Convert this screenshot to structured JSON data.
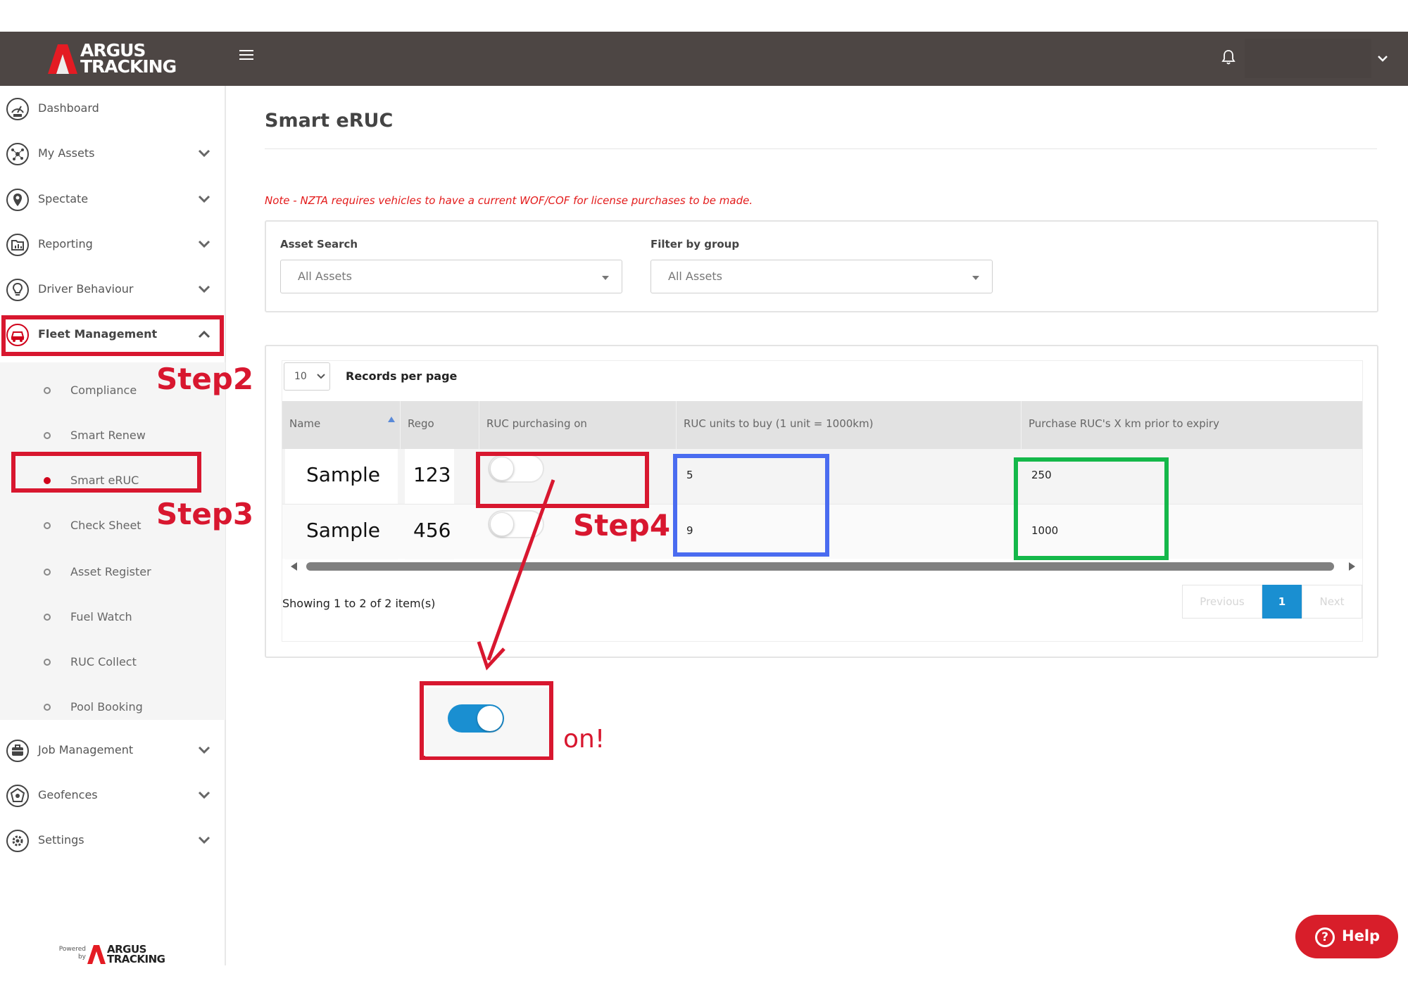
{
  "brand": {
    "line1": "ARGUS",
    "line2": "TRACKING",
    "powered_by": "Powered by",
    "accent_red": "#d0021b",
    "topbar_color": "#4d4644",
    "toggle_blue": "#1a8fd1"
  },
  "sidebar": {
    "items": [
      {
        "label": "Dashboard",
        "icon": "gauge-icon",
        "has_chevron": false
      },
      {
        "label": "My Assets",
        "icon": "network-icon",
        "has_chevron": true
      },
      {
        "label": "Spectate",
        "icon": "map-pin-icon",
        "has_chevron": true
      },
      {
        "label": "Reporting",
        "icon": "folder-chart-icon",
        "has_chevron": true
      },
      {
        "label": "Driver Behaviour",
        "icon": "lightbulb-icon",
        "has_chevron": true
      },
      {
        "label": "Fleet Management",
        "icon": "car-icon",
        "has_chevron": true,
        "expanded": true
      },
      {
        "label": "Job Management",
        "icon": "briefcase-icon",
        "has_chevron": true
      },
      {
        "label": "Geofences",
        "icon": "geofence-icon",
        "has_chevron": true
      },
      {
        "label": "Settings",
        "icon": "gear-icon",
        "has_chevron": true
      }
    ],
    "fleet_submenu": [
      {
        "label": "Compliance",
        "active": false
      },
      {
        "label": "Smart Renew",
        "active": false
      },
      {
        "label": "Smart eRUC",
        "active": true
      },
      {
        "label": "Check Sheet",
        "active": false
      },
      {
        "label": "Asset Register",
        "active": false
      },
      {
        "label": "Fuel Watch",
        "active": false
      },
      {
        "label": "RUC Collect",
        "active": false
      },
      {
        "label": "Pool Booking",
        "active": false
      }
    ]
  },
  "page": {
    "title": "Smart eRUC",
    "note": "Note - NZTA requires vehicles to have a current WOF/COF for license purchases to be made."
  },
  "filters": {
    "asset_search_label": "Asset Search",
    "asset_search_value": "All Assets",
    "group_label": "Filter by group",
    "group_value": "All Assets"
  },
  "table": {
    "records_per_page": "10",
    "records_per_page_label": "Records per page",
    "columns": [
      "Name",
      "Rego",
      "RUC purchasing on",
      "RUC units to buy (1 unit = 1000km)",
      "Purchase RUC's X km prior to expiry"
    ],
    "sort_column": "Name",
    "sort_direction": "ascending",
    "rows": [
      {
        "name": "Sample",
        "rego": "123",
        "ruc_on": false,
        "units": "5",
        "prior_km": "250"
      },
      {
        "name": "Sample",
        "rego": "456",
        "ruc_on": false,
        "units": "9",
        "prior_km": "1000"
      }
    ],
    "showing": "Showing 1 to 2 of 2 item(s)",
    "pager": {
      "previous": "Previous",
      "current": "1",
      "next": "Next"
    }
  },
  "annotations": {
    "step2": "Step2",
    "step3": "Step3",
    "step4": "Step4",
    "on_label": "on!",
    "toggle_shown_on": true,
    "red": "#d8172f",
    "blue": "#4a6cf0",
    "green": "#14b84a"
  },
  "help": {
    "label": "Help"
  }
}
